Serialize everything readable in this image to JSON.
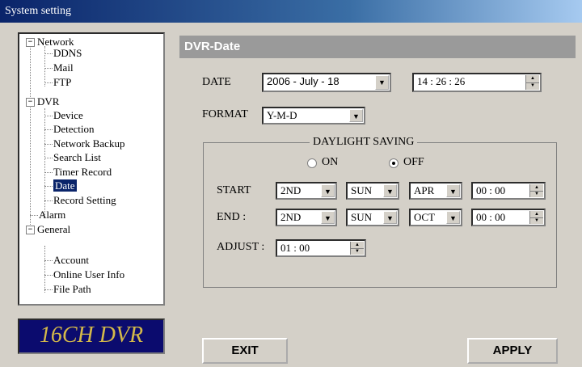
{
  "window": {
    "title": "System setting"
  },
  "tree": {
    "network": "Network",
    "ddns": "DDNS",
    "mail": "Mail",
    "ftp": "FTP",
    "dvr": "DVR",
    "device": "Device",
    "detection": "Detection",
    "network_backup": "Network Backup",
    "search_list": "Search List",
    "timer_record": "Timer Record",
    "date": "Date",
    "record_setting": "Record Setting",
    "alarm": "Alarm",
    "general": "General",
    "account": "Account",
    "online_user_info": "Online User Info",
    "file_path": "File Path",
    "expand_minus": "−"
  },
  "logo": {
    "text": "16CH DVR"
  },
  "panel": {
    "title": "DVR-Date"
  },
  "date": {
    "label": "DATE",
    "value": "2006 -  July  - 18",
    "time": "14 : 26 : 26"
  },
  "format": {
    "label": "FORMAT",
    "value": "Y-M-D"
  },
  "dst": {
    "title": "DAYLIGHT SAVING",
    "on_label": "ON",
    "off_label": "OFF",
    "selected": "OFF",
    "start_label": "START",
    "start_week": "2ND",
    "start_day": "SUN",
    "start_month": "APR",
    "start_time": "00 : 00",
    "end_label": "END :",
    "end_week": "2ND",
    "end_day": "SUN",
    "end_month": "OCT",
    "end_time": "00 : 00",
    "adjust_label": "ADJUST :",
    "adjust_value": "01 : 00"
  },
  "buttons": {
    "exit": "EXIT",
    "apply": "APPLY"
  }
}
